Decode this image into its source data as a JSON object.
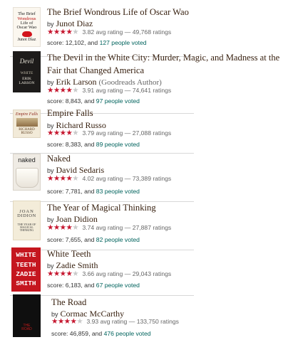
{
  "books": [
    {
      "title": "The Brief Wondrous Life of Oscar Wao",
      "by": "by",
      "author": "Junot Diaz",
      "author_note": "",
      "rating_text": "3.82 avg rating — 49,768 ratings",
      "rating_stars": 4,
      "score_prefix": "score: 12,102, and ",
      "votes_link": "127 people voted",
      "cover": {
        "lines": [
          "The Brief",
          "Wondrous",
          "Life of",
          "Oscar Wao",
          "Junot Díaz"
        ]
      }
    },
    {
      "title": "The Devil in the White City: Murder, Magic, and Madness at the Fair that Changed America",
      "by": "by",
      "author": "Erik Larson",
      "author_note": "(Goodreads Author)",
      "rating_text": "3.91 avg rating — 74,641 ratings",
      "rating_stars": 4,
      "score_prefix": "score: 8,843, and ",
      "votes_link": "97 people voted",
      "cover": {
        "lines": [
          "Devil",
          "WHITE",
          "ERIK",
          "LARSON"
        ]
      }
    },
    {
      "title": "Empire Falls",
      "by": "by",
      "author": "Richard Russo",
      "author_note": "",
      "rating_text": "3.79 avg rating — 27,088 ratings",
      "rating_stars": 4,
      "score_prefix": "score: 8,383, and ",
      "votes_link": "89 people voted",
      "cover": {
        "lines": [
          "Empire Falls",
          "RICHARD",
          "RUSSO"
        ]
      }
    },
    {
      "title": "Naked",
      "by": "by",
      "author": "David Sedaris",
      "author_note": "",
      "rating_text": "4.02 avg rating — 73,389 ratings",
      "rating_stars": 4,
      "score_prefix": "score: 7,781, and ",
      "votes_link": "83 people voted",
      "cover": {
        "lines": [
          "naked"
        ]
      }
    },
    {
      "title": "The Year of Magical Thinking",
      "by": "by",
      "author": "Joan Didion",
      "author_note": "",
      "rating_text": "3.74 avg rating — 27,887 ratings",
      "rating_stars": 4,
      "score_prefix": "score: 7,655, and ",
      "votes_link": "82 people voted",
      "cover": {
        "lines": [
          "JOAN",
          "DIDION",
          "THE YEAR OF",
          "MAGICAL",
          "THINKING"
        ]
      }
    },
    {
      "title": "White Teeth",
      "by": "by",
      "author": "Zadie Smith",
      "author_note": "",
      "rating_text": "3.66 avg rating — 29,043 ratings",
      "rating_stars": 4,
      "score_prefix": "score: 6,183, and ",
      "votes_link": "67 people voted",
      "cover": {
        "lines": [
          "WHITE",
          "TEETH",
          "ZADIE",
          "SMITH"
        ]
      }
    },
    {
      "title": "The Road",
      "by": "by",
      "author": "Cormac McCarthy",
      "author_note": "",
      "rating_text": "3.93 avg rating — 133,750 ratings",
      "rating_stars": 4,
      "score_prefix": "score: 46,859, and ",
      "votes_link": "476 people voted",
      "cover": {
        "lines": [
          "THE",
          "ROAD"
        ]
      }
    }
  ],
  "colors": {
    "title": "#382110",
    "link": "#00635d",
    "star_on": "#c5162e",
    "star_off": "#c9c9c9"
  }
}
